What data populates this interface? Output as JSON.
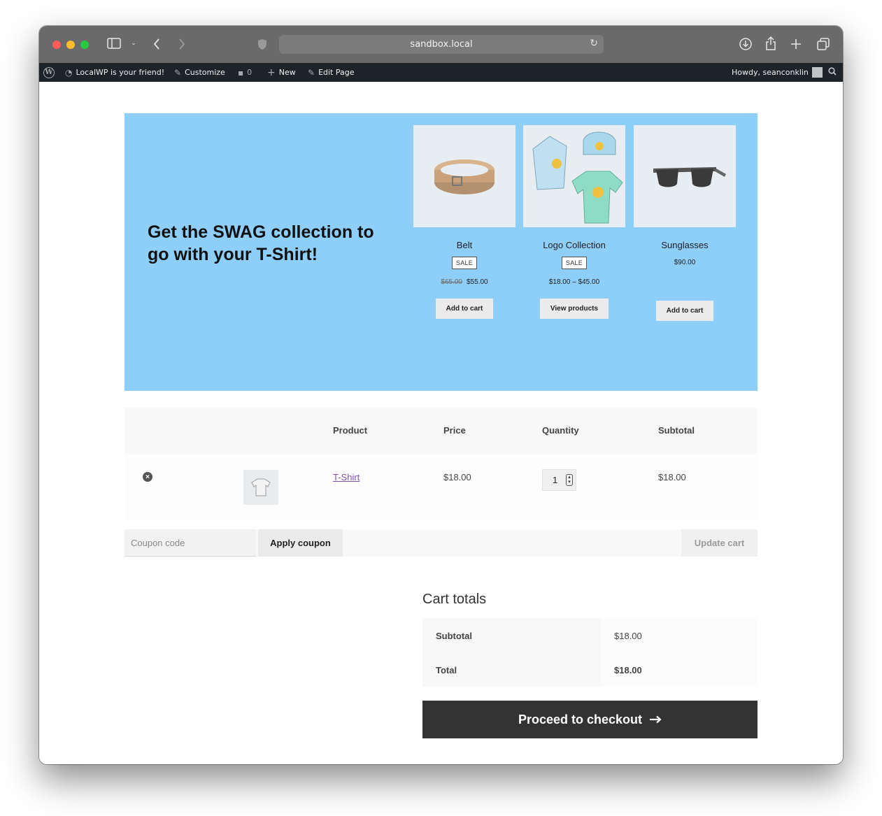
{
  "browser": {
    "url": "sandbox.local"
  },
  "admin_bar": {
    "site_name": "LocalWP is your friend!",
    "customize": "Customize",
    "comments_count": "0",
    "new": "New",
    "edit_page": "Edit Page",
    "howdy": "Howdy, seanconklin"
  },
  "banner": {
    "heading": "Get the SWAG collection to go with your T-Shirt!",
    "products": [
      {
        "name": "Belt",
        "badge": "SALE",
        "old_price": "$65.00",
        "price": "$55.00",
        "button": "Add to cart"
      },
      {
        "name": "Logo Collection",
        "badge": "SALE",
        "price": "$18.00 – $45.00",
        "button": "View products"
      },
      {
        "name": "Sunglasses",
        "price": "$90.00",
        "button": "Add to cart"
      }
    ]
  },
  "cart": {
    "headers": {
      "product": "Product",
      "price": "Price",
      "quantity": "Quantity",
      "subtotal": "Subtotal"
    },
    "items": [
      {
        "name": "T-Shirt",
        "price": "$18.00",
        "quantity": "1",
        "subtotal": "$18.00"
      }
    ],
    "coupon_placeholder": "Coupon code",
    "apply_coupon": "Apply coupon",
    "update_cart": "Update cart"
  },
  "totals": {
    "title": "Cart totals",
    "subtotal_label": "Subtotal",
    "subtotal_value": "$18.00",
    "total_label": "Total",
    "total_value": "$18.00",
    "checkout": "Proceed to checkout"
  },
  "colors": {
    "banner_bg": "#8ecffa",
    "checkout_bg": "#333333",
    "link": "#7f54b3",
    "admin_bar_bg": "#1d2327"
  }
}
